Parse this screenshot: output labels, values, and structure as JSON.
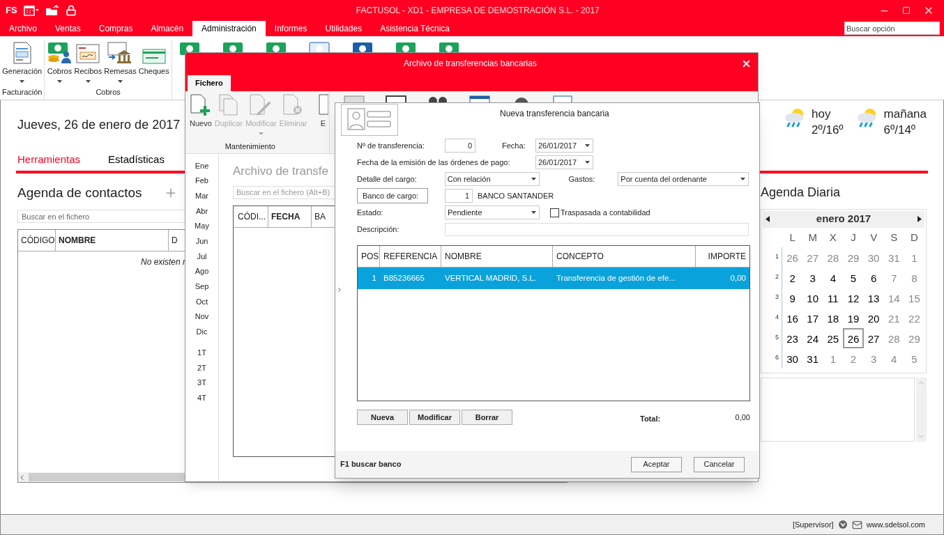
{
  "app": {
    "logo": "FS",
    "title": "FACTUSOL - XD1 - EMPRESA DE DEMOSTRACIÓN S.L. - 2017"
  },
  "menu": [
    {
      "label": "Archivo",
      "selected": false
    },
    {
      "label": "Ventas",
      "selected": false
    },
    {
      "label": "Compras",
      "selected": false
    },
    {
      "label": "Almacén",
      "selected": false
    },
    {
      "label": "Administración",
      "selected": true
    },
    {
      "label": "Informes",
      "selected": false
    },
    {
      "label": "Utilidades",
      "selected": false
    },
    {
      "label": "Asistencia Técnica",
      "selected": false
    }
  ],
  "search": {
    "placeholder": "Buscar opción"
  },
  "ribbon": [
    {
      "label": "Facturación",
      "items": [
        {
          "label": "Generación",
          "kind": "invoice",
          "dropdown": true
        }
      ]
    },
    {
      "label": "Cobros",
      "items": [
        {
          "label": "Cobros",
          "kind": "payer",
          "dropdown": true
        },
        {
          "label": "Recibos",
          "kind": "receipt",
          "dropdown": true
        },
        {
          "label": "Remesas",
          "kind": "bank",
          "dropdown": true
        },
        {
          "label": "Cheques",
          "kind": "cheque",
          "dropdown": false
        }
      ]
    }
  ],
  "home": {
    "date": "Jueves, 26 de enero de 2017",
    "tabs": [
      {
        "label": "Herramientas",
        "selected": true
      },
      {
        "label": "Estadísticas",
        "selected": false
      }
    ],
    "contacts": {
      "title": "Agenda de contactos",
      "search_placeholder": "Buscar en el fichero",
      "columns": [
        {
          "label": "CÓDIGO",
          "sorted": false
        },
        {
          "label": "NOMBRE",
          "sorted": true
        },
        {
          "label": "D",
          "sorted": false
        }
      ],
      "empty_text": "No existen r"
    },
    "weather": [
      {
        "day": "hoy",
        "temps": "2º/16º"
      },
      {
        "day": "mañana",
        "temps": "6º/14º"
      }
    ],
    "agenda": {
      "title": "Agenda Diaria",
      "month": "enero 2017",
      "weekdays": [
        "L",
        "M",
        "X",
        "J",
        "V",
        "S",
        "D"
      ],
      "weeks": [
        {
          "number": "1",
          "days": [
            {
              "label": "26",
              "muted": true,
              "selected": false
            },
            {
              "label": "27",
              "muted": true,
              "selected": false
            },
            {
              "label": "28",
              "muted": true,
              "selected": false
            },
            {
              "label": "29",
              "muted": true,
              "selected": false
            },
            {
              "label": "30",
              "muted": true,
              "selected": false
            },
            {
              "label": "31",
              "muted": true,
              "selected": false
            },
            {
              "label": "1",
              "muted": true,
              "selected": false
            }
          ]
        },
        {
          "number": "2",
          "days": [
            {
              "label": "2",
              "muted": false,
              "selected": false
            },
            {
              "label": "3",
              "muted": false,
              "selected": false
            },
            {
              "label": "4",
              "muted": false,
              "selected": false
            },
            {
              "label": "5",
              "muted": false,
              "selected": false
            },
            {
              "label": "6",
              "muted": false,
              "selected": false
            },
            {
              "label": "7",
              "muted": true,
              "selected": false
            },
            {
              "label": "8",
              "muted": true,
              "selected": false
            }
          ]
        },
        {
          "number": "3",
          "days": [
            {
              "label": "9",
              "muted": false,
              "selected": false
            },
            {
              "label": "10",
              "muted": false,
              "selected": false
            },
            {
              "label": "11",
              "muted": false,
              "selected": false
            },
            {
              "label": "12",
              "muted": false,
              "selected": false
            },
            {
              "label": "13",
              "muted": false,
              "selected": false
            },
            {
              "label": "14",
              "muted": true,
              "selected": false
            },
            {
              "label": "15",
              "muted": true,
              "selected": false
            }
          ]
        },
        {
          "number": "4",
          "days": [
            {
              "label": "16",
              "muted": false,
              "selected": false
            },
            {
              "label": "17",
              "muted": false,
              "selected": false
            },
            {
              "label": "18",
              "muted": false,
              "selected": false
            },
            {
              "label": "19",
              "muted": false,
              "selected": false
            },
            {
              "label": "20",
              "muted": false,
              "selected": false
            },
            {
              "label": "21",
              "muted": true,
              "selected": false
            },
            {
              "label": "22",
              "muted": true,
              "selected": false
            }
          ]
        },
        {
          "number": "5",
          "days": [
            {
              "label": "23",
              "muted": false,
              "selected": false
            },
            {
              "label": "24",
              "muted": false,
              "selected": false
            },
            {
              "label": "25",
              "muted": false,
              "selected": false
            },
            {
              "label": "26",
              "muted": false,
              "selected": true
            },
            {
              "label": "27",
              "muted": false,
              "selected": false
            },
            {
              "label": "28",
              "muted": true,
              "selected": false
            },
            {
              "label": "29",
              "muted": true,
              "selected": false
            }
          ]
        },
        {
          "number": "6",
          "days": [
            {
              "label": "30",
              "muted": false,
              "selected": false
            },
            {
              "label": "31",
              "muted": false,
              "selected": false
            },
            {
              "label": "1",
              "muted": true,
              "selected": false
            },
            {
              "label": "2",
              "muted": true,
              "selected": false
            },
            {
              "label": "3",
              "muted": true,
              "selected": false
            },
            {
              "label": "4",
              "muted": true,
              "selected": false
            },
            {
              "label": "5",
              "muted": true,
              "selected": false
            }
          ]
        }
      ]
    }
  },
  "transfers_window": {
    "title": "Archivo de transferencias bancarias",
    "tabs": [
      {
        "label": "Fichero",
        "selected": true
      }
    ],
    "toolbar": [
      {
        "label": "Nuevo",
        "kind": "new",
        "disabled": false,
        "dropdown": false
      },
      {
        "label": "Duplicar",
        "kind": "copy",
        "disabled": true,
        "dropdown": false
      },
      {
        "label": "Modificar",
        "kind": "edit",
        "disabled": true,
        "dropdown": true
      },
      {
        "label": "Eliminar",
        "kind": "delete",
        "disabled": true,
        "dropdown": false
      },
      {
        "label": "E",
        "kind": "doc",
        "disabled": false,
        "dropdown": false
      }
    ],
    "group_label": "Mantenimiento",
    "months": [
      "Ene",
      "Feb",
      "Mar",
      "Abr",
      "May",
      "Jun",
      "Jul",
      "Ago",
      "Sep",
      "Oct",
      "Nov",
      "Dic"
    ],
    "quarters": [
      "1T",
      "2T",
      "3T",
      "4T"
    ],
    "heading": "Archivo de transfe",
    "search_placeholder": "Buscar en el fichero (Alt+B)",
    "columns": [
      {
        "label": "CÓDI...",
        "sorted": false
      },
      {
        "label": "FECHA",
        "sorted": true
      },
      {
        "label": "BA",
        "sorted": false
      }
    ]
  },
  "dialog": {
    "title": "Nueva transferencia bancaria",
    "number": {
      "label": "Nº de transferencia:",
      "value": "0"
    },
    "date": {
      "label": "Fecha:",
      "value": "26/01/2017"
    },
    "issue_date": {
      "label": "Fecha de la emisión de las órdenes de pago:",
      "value": "26/01/2017"
    },
    "charge_detail": {
      "label": "Detalle del cargo:",
      "value": "Con relación"
    },
    "expenses": {
      "label": "Gastos:",
      "value": "Por cuenta del ordenante"
    },
    "bank": {
      "button": "Banco de cargo:",
      "code": "1",
      "name": "BANCO SANTANDER"
    },
    "status": {
      "label": "Estado:",
      "value": "Pendiente"
    },
    "posted": {
      "label": "Traspasada a contabilidad",
      "checked": false
    },
    "description": {
      "label": "Descripción:"
    },
    "columns": [
      "POS",
      "REFERENCIA",
      "NOMBRE",
      "CONCEPTO",
      "IMPORTE"
    ],
    "rows": [
      {
        "selected": true,
        "cells": [
          "1",
          "B85236665",
          "VERTICAL MADRID, S.L.",
          "Transferencia de gestión de efe...",
          "0,00"
        ]
      }
    ],
    "row_buttons": [
      "Nueva",
      "Modificar",
      "Borrar"
    ],
    "total": {
      "label": "Total:",
      "value": "0,00"
    },
    "hint": "F1 buscar banco",
    "buttons": [
      "Aceptar",
      "Cancelar"
    ]
  },
  "status_bar": {
    "user": "[Supervisor]",
    "website": "www.sdelsol.com"
  }
}
